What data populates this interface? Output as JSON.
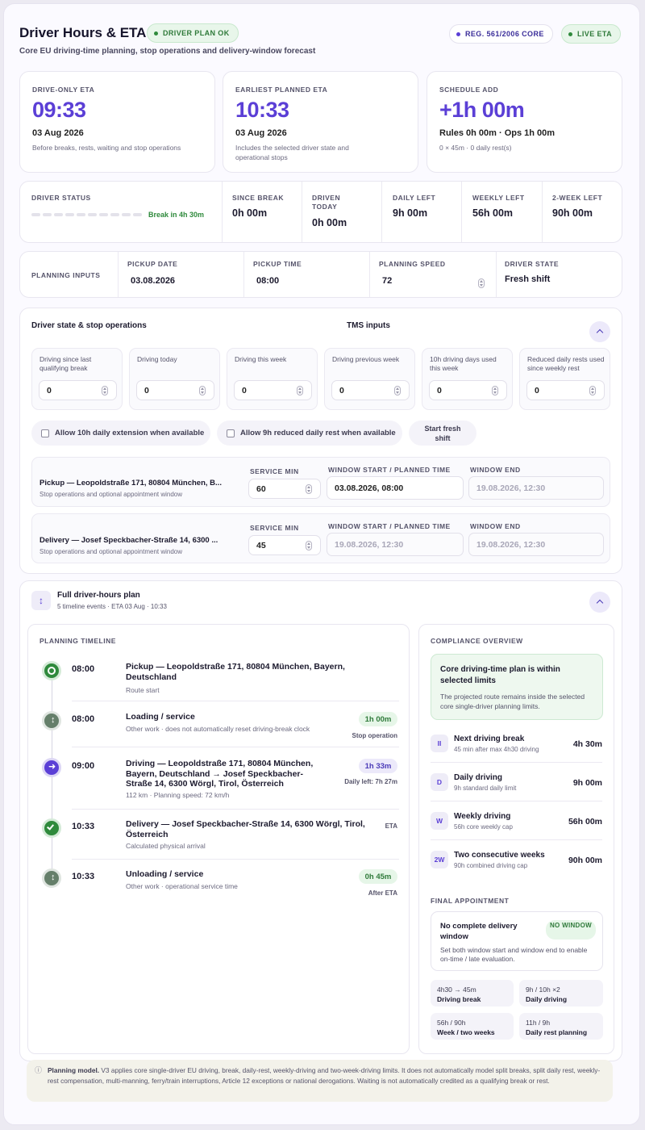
{
  "header": {
    "title": "Driver Hours & ETA",
    "status_badge": "DRIVER PLAN OK",
    "subtitle": "Core EU driving-time planning, stop operations and delivery-window forecast",
    "reg_badge": "REG. 561/2006 CORE",
    "live_badge": "LIVE ETA"
  },
  "eta_cards": [
    {
      "label": "DRIVE-ONLY ETA",
      "value": "09:33",
      "date": "03 Aug 2026",
      "note": "Before breaks, rests, waiting and stop operations"
    },
    {
      "label": "EARLIEST PLANNED ETA",
      "value": "10:33",
      "date": "03 Aug 2026",
      "note": "Includes the selected driver state and operational stops"
    },
    {
      "label": "SCHEDULE ADD",
      "value": "+1h 00m",
      "date": "Rules 0h 00m · Ops 1h 00m",
      "note": "0 × 45m · 0 daily rest(s)"
    }
  ],
  "driver_status": {
    "label": "DRIVER STATUS",
    "break_text": "Break in 4h 30m",
    "metrics": [
      {
        "label": "SINCE BREAK",
        "value": "0h 00m"
      },
      {
        "label": "DRIVEN TODAY",
        "value": "0h 00m"
      },
      {
        "label": "DAILY LEFT",
        "value": "9h 00m"
      },
      {
        "label": "WEEKLY LEFT",
        "value": "56h 00m"
      },
      {
        "label": "2-WEEK LEFT",
        "value": "90h 00m"
      }
    ]
  },
  "planning": {
    "label": "PLANNING INPUTS",
    "pickup_date_label": "PICKUP DATE",
    "pickup_date": "03.08.2026",
    "pickup_time_label": "PICKUP TIME",
    "pickup_time": "08:00",
    "speed_label": "PLANNING SPEED",
    "speed": "72",
    "state_label": "DRIVER STATE",
    "state": "Fresh shift"
  },
  "stops_section": {
    "title": "Driver state & stop operations",
    "tms": "TMS inputs",
    "fields": [
      {
        "label": "Driving since last qualifying break",
        "value": "0"
      },
      {
        "label": "Driving today",
        "value": "0"
      },
      {
        "label": "Driving this week",
        "value": "0"
      },
      {
        "label": "Driving previous week",
        "value": "0"
      },
      {
        "label": "10h driving days used this week",
        "value": "0"
      },
      {
        "label": "Reduced daily rests used since weekly rest",
        "value": "0"
      }
    ],
    "cb1": "Allow 10h daily extension when available",
    "cb2": "Allow 9h reduced daily rest when available",
    "fresh_btn": "Start fresh shift",
    "service_label": "SERVICE MIN",
    "window_start_label": "WINDOW START / PLANNED TIME",
    "window_end_label": "WINDOW END",
    "stops": [
      {
        "name": "Pickup — Leopoldstraße 171, 80804 München, B...",
        "sub": "Stop operations and optional appointment window",
        "service": "60",
        "start": "03.08.2026, 08:00",
        "end": "19.08.2026, 12:30"
      },
      {
        "name": "Delivery — Josef Speckbacher-Straße 14, 6300 ...",
        "sub": "Stop operations and optional appointment window",
        "service": "45",
        "start": "19.08.2026, 12:30",
        "end": "19.08.2026, 12:30"
      }
    ]
  },
  "plan": {
    "icon": "↕",
    "title": "Full driver-hours plan",
    "sub": "5 timeline events · ETA 03 Aug · 10:33"
  },
  "timeline": {
    "label": "PLANNING TIMELINE",
    "events": [
      {
        "time": "08:00",
        "title": "Pickup — Leopoldstraße 171, 80804 München, Bayern, Deutschland",
        "sub": "Route start",
        "dur": "",
        "tag": ""
      },
      {
        "time": "08:00",
        "title": "Loading / service",
        "sub": "Other work · does not automatically reset driving-break clock",
        "dur": "1h 00m",
        "tag": "Stop operation"
      },
      {
        "time": "09:00",
        "title": "Driving — Leopoldstraße 171, 80804 München, Bayern, Deutschland → Josef Speckbacher-Straße 14, 6300 Wörgl, Tirol, Österreich",
        "sub": "112 km · Planning speed: 72 km/h",
        "dur": "1h 33m",
        "tag": "Daily left: 7h 27m"
      },
      {
        "time": "10:33",
        "title": "Delivery — Josef Speckbacher-Straße 14, 6300 Wörgl, Tirol, Österreich",
        "sub": "Calculated physical arrival",
        "dur": "",
        "tag": "ETA"
      },
      {
        "time": "10:33",
        "title": "Unloading / service",
        "sub": "Other work · operational service time",
        "dur": "0h 45m",
        "tag": "After ETA"
      }
    ]
  },
  "compliance": {
    "label": "COMPLIANCE OVERVIEW",
    "ok_title": "Core driving-time plan is within selected limits",
    "ok_sub": "The projected route remains inside the selected core single-driver planning limits.",
    "rows": [
      {
        "icon": "II",
        "title": "Next driving break",
        "sub": "45 min after max 4h30 driving",
        "value": "4h 30m"
      },
      {
        "icon": "D",
        "title": "Daily driving",
        "sub": "9h standard daily limit",
        "value": "9h 00m"
      },
      {
        "icon": "W",
        "title": "Weekly driving",
        "sub": "56h core weekly cap",
        "value": "56h 00m"
      },
      {
        "icon": "2W",
        "title": "Two consecutive weeks",
        "sub": "90h combined driving cap",
        "value": "90h 00m"
      }
    ],
    "final_label": "FINAL APPOINTMENT",
    "final_title": "No complete delivery window",
    "final_badge": "NO WINDOW",
    "final_sub": "Set both window start and window end to enable on-time / late evaluation.",
    "chips": [
      {
        "a": "4h30 → 45m",
        "b": "Driving break"
      },
      {
        "a": "9h / 10h ×2",
        "b": "Daily driving"
      },
      {
        "a": "56h / 90h",
        "b": "Week / two weeks"
      },
      {
        "a": "11h / 9h",
        "b": "Daily rest planning"
      }
    ]
  },
  "footer": {
    "icon": "ⓘ",
    "bold": "Planning model.",
    "text": "V3 applies core single-driver EU driving, break, daily-rest, weekly-driving and two-week-driving limits. It does not automatically model split breaks, split daily rest, weekly-rest compensation, multi-manning, ferry/train interruptions, Article 12 exceptions or national derogations. Waiting is not automatically credited as a qualifying break or rest."
  },
  "colors": {
    "accent": "#5b3fd6",
    "ok_green": "#2f8a3c",
    "badge_green_bg": "#e6f6e8",
    "muted_icon": "#6e8a74"
  }
}
